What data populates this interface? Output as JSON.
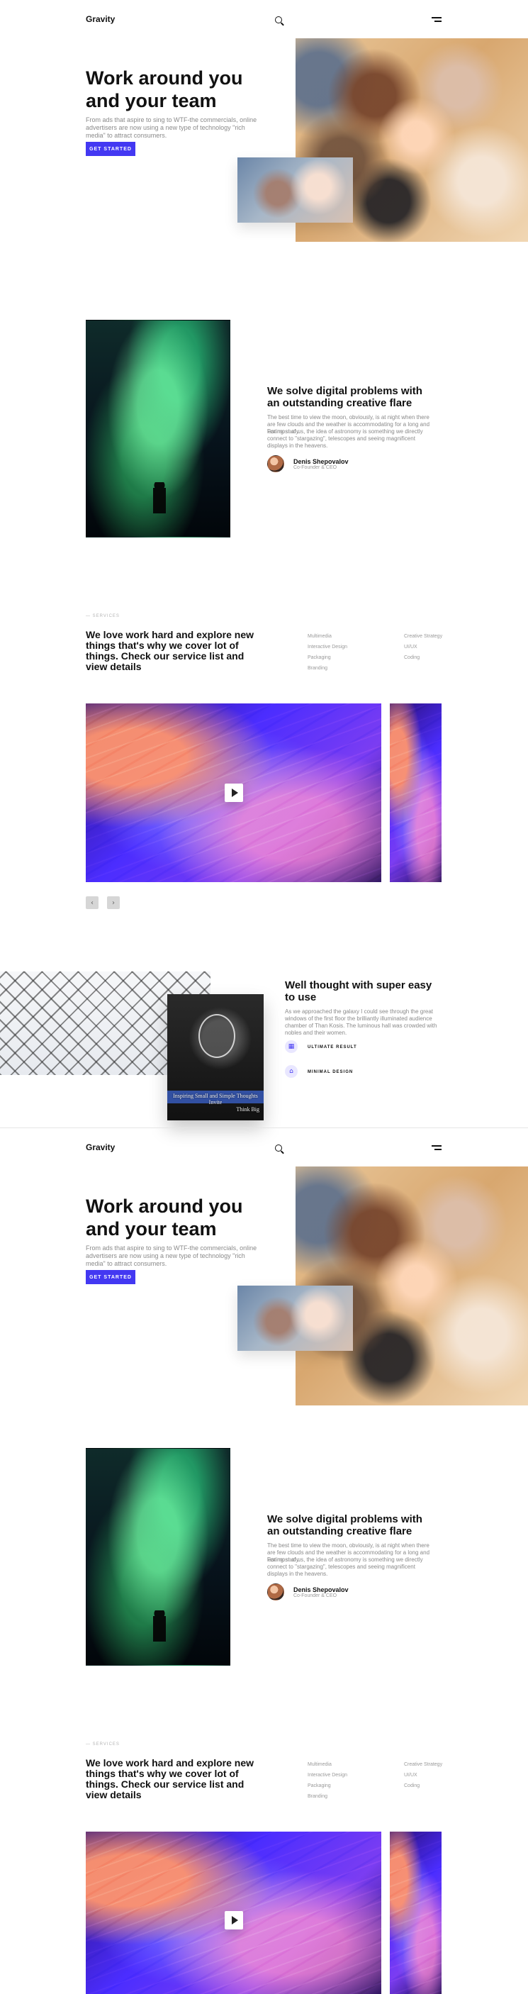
{
  "header": {
    "brand": "Gravity"
  },
  "hero": {
    "title": "Work around you and your team",
    "subtitle": "From ads that aspire to sing to WTF-the commercials, online advertisers are now using a new type of technology \"rich media\" to attract consumers.",
    "cta": "GET STARTED"
  },
  "about": {
    "heading": "We solve digital problems with an outstanding creative flare",
    "p1": "The best time to view the moon, obviously, is at night when there are few clouds and the weather is accommodating for a long and lasting study.",
    "p2": "For most of us, the idea of astronomy is something we directly connect to \"stargazing\", telescopes and seeing magnificent displays in the heavens.",
    "author_name": "Denis Shepovalov",
    "author_role": "Co-Founder & CEO"
  },
  "services": {
    "kicker": "— SERVICES",
    "heading": "We love work hard and explore new things that's why we cover lot of things. Check our service list and view details",
    "col1": [
      "Multimedia",
      "Interactive Design",
      "Packaging",
      "Branding"
    ],
    "col2": [
      "Creative Strategy",
      "UI/UX",
      "Coding"
    ],
    "prev": "‹",
    "next": "›"
  },
  "easy": {
    "heading": "Well thought with super easy to use",
    "text": "As we approached the galaxy I could see through the great windows of the first floor the brilliantly illuminated audience chamber of Than Kosis. The luminous hall was crowded with nobles and their women.",
    "f1": "ULTIMATE RESULT",
    "f2": "MINIMAL DESIGN",
    "bulb_line1": "Inspiring Small and Simple Thoughts Invite",
    "bulb_line2": "Think Big"
  },
  "colors": {
    "accent": "#4338f2"
  }
}
